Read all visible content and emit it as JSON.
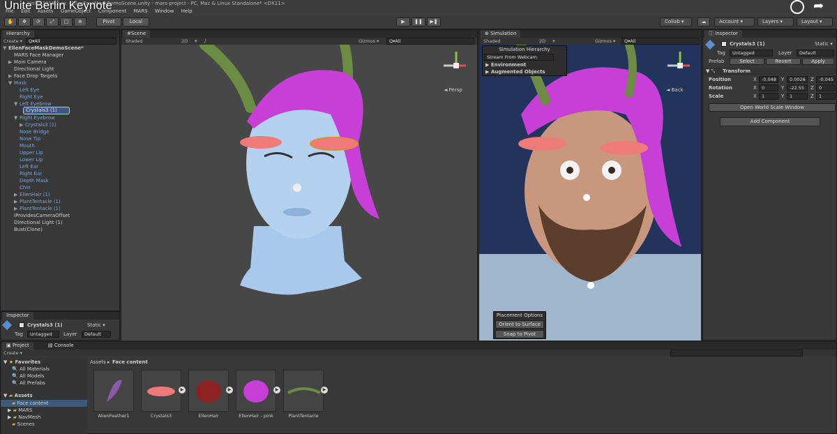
{
  "video_title": "Unite Berlin Keynote",
  "window_title": "Unity 2018.x.xx - EllenFaceMaskDemoScene.unity - mars-project - PC, Mac & Linux Standalone* <DX11>",
  "menu": [
    "File",
    "Edit",
    "Assets",
    "GameObject",
    "Component",
    "MARS",
    "Window",
    "Help"
  ],
  "toolbar": {
    "pivot": "Pivot",
    "local": "Local",
    "collab": "Collab ▾",
    "account": "Account ▾",
    "layers": "Layers ▾",
    "layout": "Layout ▾"
  },
  "hierarchy": {
    "tab": "Hierarchy",
    "create": "Create ▾",
    "search": "Q▾All",
    "items": [
      {
        "label": "EllenFaceMaskDemoScene*",
        "indent": 0,
        "arrow": "▼",
        "blue": false,
        "bold": true
      },
      {
        "label": "MARS Face Manager",
        "indent": 1,
        "arrow": "",
        "blue": false
      },
      {
        "label": "Main Camera",
        "indent": 1,
        "arrow": "▶",
        "blue": false
      },
      {
        "label": "Directional Light",
        "indent": 1,
        "arrow": "",
        "blue": false
      },
      {
        "label": "Face Drop Targets",
        "indent": 1,
        "arrow": "▶",
        "blue": false
      },
      {
        "label": "Mask",
        "indent": 1,
        "arrow": "▼",
        "blue": true
      },
      {
        "label": "Left Eye",
        "indent": 2,
        "arrow": "",
        "blue": true
      },
      {
        "label": "Right Eye",
        "indent": 2,
        "arrow": "",
        "blue": true
      },
      {
        "label": "Left Eyebrow",
        "indent": 2,
        "arrow": "▼",
        "blue": true
      },
      {
        "label": "",
        "indent": 3,
        "arrow": "",
        "blue": true
      },
      {
        "label": "Right Eyebrow",
        "indent": 2,
        "arrow": "▼",
        "blue": true
      },
      {
        "label": "Crystals3 (1)",
        "indent": 3,
        "arrow": "▶",
        "blue": true
      },
      {
        "label": "Nose Bridge",
        "indent": 2,
        "arrow": "",
        "blue": true
      },
      {
        "label": "Nose Tip",
        "indent": 2,
        "arrow": "",
        "blue": true
      },
      {
        "label": "Mouth",
        "indent": 2,
        "arrow": "",
        "blue": true
      },
      {
        "label": "Upper Lip",
        "indent": 2,
        "arrow": "",
        "blue": true
      },
      {
        "label": "Lower Lip",
        "indent": 2,
        "arrow": "",
        "blue": true
      },
      {
        "label": "Left Ear",
        "indent": 2,
        "arrow": "",
        "blue": true
      },
      {
        "label": "Right Ear",
        "indent": 2,
        "arrow": "",
        "blue": true
      },
      {
        "label": "Depth Mask",
        "indent": 2,
        "arrow": "",
        "blue": true
      },
      {
        "label": "Chin",
        "indent": 2,
        "arrow": "",
        "blue": true
      },
      {
        "label": "EllenHair (1)",
        "indent": 2,
        "arrow": "▶",
        "blue": true
      },
      {
        "label": "PlantTentacle (1)",
        "indent": 2,
        "arrow": "▶",
        "blue": true
      },
      {
        "label": "PlantTentacle (1)",
        "indent": 2,
        "arrow": "▶",
        "blue": true
      },
      {
        "label": "IProvidesCameraOffset",
        "indent": 1,
        "arrow": "",
        "blue": false
      },
      {
        "label": "Directional Light (1)",
        "indent": 1,
        "arrow": "",
        "blue": false
      },
      {
        "label": "Bust(Clone)",
        "indent": 1,
        "arrow": "",
        "blue": false
      }
    ],
    "selected": "Crystals3 (1)"
  },
  "scene": {
    "tab": "Scene",
    "shaded": "Shaded",
    "mode2d": "2D",
    "gizmos": "Gizmos ▾",
    "search": "Q▾All",
    "persp": "◄ Persp"
  },
  "simulation": {
    "tab": "Simulation",
    "shaded": "Shaded",
    "mode2d": "2D",
    "gizmos": "Gizmos ▾",
    "search": "Q▾All",
    "back": "◄ Back",
    "hier_title": "Simulation Hierarchy",
    "stream": "Stream From Webcam",
    "env": "Environment",
    "aug": "Augmented Objects",
    "placement": "Placement Options",
    "orient": "Orient to Surface",
    "snap": "Snap to Pivot"
  },
  "inspector": {
    "tab": "Inspector",
    "object": "Crystals3 (1)",
    "static": "Static ▾",
    "tag_label": "Tag",
    "tag": "Untagged",
    "layer_label": "Layer",
    "layer": "Default",
    "prefab_label": "Prefab",
    "select": "Select",
    "revert": "Revert",
    "apply": "Apply",
    "transform": "Transform",
    "position": "Position",
    "rotation": "Rotation",
    "scale": "Scale",
    "pos": {
      "x": "-0.048",
      "y": "0.0026",
      "z": "-0.045"
    },
    "rot": {
      "x": "0",
      "y": "-22.55",
      "z": "0"
    },
    "scl": {
      "x": "1",
      "y": "1",
      "z": "1"
    },
    "open_world": "Open World Scale Window",
    "add_component": "Add Component"
  },
  "inspector_small": {
    "tab": "Inspector",
    "object": "Crystals3 (1)",
    "static": "Static ▾",
    "tag_label": "Tag",
    "tag": "Untagged",
    "layer_label": "Layer",
    "layer": "Default"
  },
  "project": {
    "tab_project": "Project",
    "tab_console": "Console",
    "create": "Create ▾",
    "favorites": "Favorites",
    "fav_items": [
      "All Materials",
      "All Models",
      "All Prefabs"
    ],
    "assets": "Assets",
    "asset_folders": [
      "Face content",
      "MARS",
      "NavMesh",
      "Scenes"
    ],
    "breadcrumb_root": "Assets ▸",
    "breadcrumb": "Face content",
    "items": [
      "AlienFeather1",
      "Crystals3",
      "EllenHair",
      "EllenHair - pink",
      "PlantTentacle"
    ]
  },
  "colors": {
    "hair": "#c73fd6",
    "crystal": "#ee7a7a",
    "skin": "#a9c8ec",
    "accent": "#d7d46a",
    "selection": "#3c5a7a"
  }
}
